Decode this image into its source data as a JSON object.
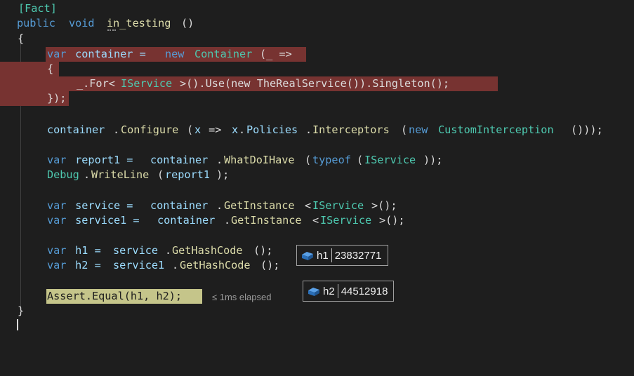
{
  "code": {
    "attribute": "[Fact]",
    "signature": {
      "public": "public",
      "void": "void",
      "name": "in_testing",
      "parens": "()"
    },
    "open_brace": "{",
    "close_brace": "}",
    "l_var_container": {
      "var": "var",
      "rest1": " container = ",
      "new": "new",
      "sp": " ",
      "type": "Container",
      "rest2": "(_ =>"
    },
    "l_inner_open": "{",
    "l_for": {
      "pre": "_.For<",
      "iface": "IService",
      "mid": ">().Use(new TheRealService()).Singleton();"
    },
    "l_inner_close": "});",
    "l_configure": {
      "obj": "container",
      "dot": ".",
      "method": "Configure",
      "p1": "(",
      "x": "x",
      "arrow": " => ",
      "x2": "x",
      "dot2": ".",
      "pol": "Policies",
      "dot3": ".",
      "inter": "Interceptors",
      "p2": "(",
      "new": "new",
      "sp": " ",
      "type": "CustomInterception",
      "end": "()));"
    },
    "l_report": {
      "var": "var",
      "rest": " report1 = ",
      "obj": "container",
      "dot": ".",
      "method": "WhatDoIHave",
      "p1": "(",
      "typeof": "typeof",
      "p2": "(",
      "iface": "IService",
      "end": "));"
    },
    "l_debug": {
      "type": "Debug",
      "dot": ".",
      "method": "WriteLine",
      "p1": "(",
      "arg": "report1",
      "end": ");"
    },
    "l_service": {
      "var": "var",
      "rest": " service = ",
      "obj": "container",
      "dot": ".",
      "method": "GetInstance",
      "lt": "<",
      "iface": "IService",
      "end": ">();"
    },
    "l_service1": {
      "var": "var",
      "rest": " service1 = ",
      "obj": "container",
      "dot": ".",
      "method": "GetInstance",
      "lt": "<",
      "iface": "IService",
      "end": ">();"
    },
    "l_h1": {
      "var": "var",
      "rest": " h1 = ",
      "obj": "service",
      "dot": ".",
      "method": "GetHashCode",
      "end": "();"
    },
    "l_h2": {
      "var": "var",
      "rest": " h2 = ",
      "obj": "service1",
      "dot": ".",
      "method": "GetHashCode",
      "end": "();"
    },
    "l_assert": "Assert.Equal(h1, h2);",
    "elapsed": "≤ 1ms elapsed"
  },
  "datatips": [
    {
      "name": "h1",
      "value": "23832771",
      "icon": "field-icon"
    },
    {
      "name": "h2",
      "value": "44512918",
      "icon": "field-icon"
    }
  ],
  "colors": {
    "background": "#1e1e1e",
    "keyword": "#569cd6",
    "type": "#4ec9b0",
    "method": "#dcdcaa",
    "identifier": "#9cdcfe",
    "breakpoint_highlight": "#773331",
    "current_statement": "#c5c58a"
  }
}
